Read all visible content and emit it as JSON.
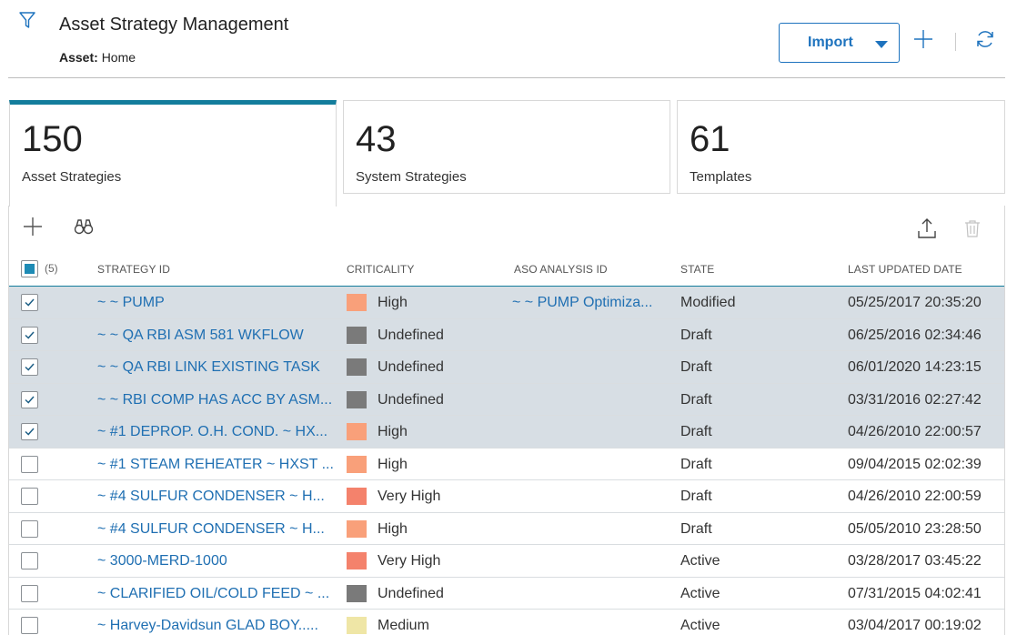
{
  "header": {
    "title": "Asset Strategy Management",
    "asset_label": "Asset:",
    "asset_value": "Home",
    "import_label": "Import"
  },
  "tiles": [
    {
      "count": "150",
      "label": "Asset Strategies"
    },
    {
      "count": "43",
      "label": "System Strategies"
    },
    {
      "count": "61",
      "label": "Templates"
    }
  ],
  "table": {
    "selected_count": "(5)",
    "columns": [
      "STRATEGY ID",
      "CRITICALITY",
      "ASO ANALYSIS ID",
      "STATE",
      "LAST UPDATED DATE"
    ],
    "rows": [
      {
        "checked": true,
        "id": "~ ~ PUMP",
        "criticality": "High",
        "color": "#f9a07a",
        "aso": "~ ~ PUMP Optimiza...",
        "state": "Modified",
        "date": "05/25/2017 20:35:20"
      },
      {
        "checked": true,
        "id": "~ ~ QA RBI ASM 581 WKFLOW",
        "criticality": "Undefined",
        "color": "#7a7a7a",
        "aso": "",
        "state": "Draft",
        "date": "06/25/2016 02:34:46"
      },
      {
        "checked": true,
        "id": "~ ~ QA RBI LINK EXISTING TASK",
        "criticality": "Undefined",
        "color": "#7a7a7a",
        "aso": "",
        "state": "Draft",
        "date": "06/01/2020 14:23:15"
      },
      {
        "checked": true,
        "id": "~ ~ RBI COMP HAS ACC BY ASM...",
        "criticality": "Undefined",
        "color": "#7a7a7a",
        "aso": "",
        "state": "Draft",
        "date": "03/31/2016 02:27:42"
      },
      {
        "checked": true,
        "id": "~ #1 DEPROP. O.H. COND. ~ HX...",
        "criticality": "High",
        "color": "#f9a07a",
        "aso": "",
        "state": "Draft",
        "date": "04/26/2010 22:00:57"
      },
      {
        "checked": false,
        "id": "~ #1 STEAM REHEATER ~ HXST ...",
        "criticality": "High",
        "color": "#f9a07a",
        "aso": "",
        "state": "Draft",
        "date": "09/04/2015 02:02:39"
      },
      {
        "checked": false,
        "id": "~ #4 SULFUR CONDENSER ~ H...",
        "criticality": "Very High",
        "color": "#f4826c",
        "aso": "",
        "state": "Draft",
        "date": "04/26/2010 22:00:59"
      },
      {
        "checked": false,
        "id": "~ #4 SULFUR CONDENSER ~ H...",
        "criticality": "High",
        "color": "#f9a07a",
        "aso": "",
        "state": "Draft",
        "date": "05/05/2010 23:28:50"
      },
      {
        "checked": false,
        "id": "~ 3000-MERD-1000",
        "criticality": "Very High",
        "color": "#f4826c",
        "aso": "",
        "state": "Active",
        "date": "03/28/2017 03:45:22"
      },
      {
        "checked": false,
        "id": "~ CLARIFIED OIL/COLD FEED ~ ...",
        "criticality": "Undefined",
        "color": "#7a7a7a",
        "aso": "",
        "state": "Active",
        "date": "07/31/2015 04:02:41"
      },
      {
        "checked": false,
        "id": "~ Harvey-Davidsun GLAD BOY.....",
        "criticality": "Medium",
        "color": "#efe6a6",
        "aso": "",
        "state": "Active",
        "date": "03/04/2017 00:19:02"
      }
    ]
  }
}
